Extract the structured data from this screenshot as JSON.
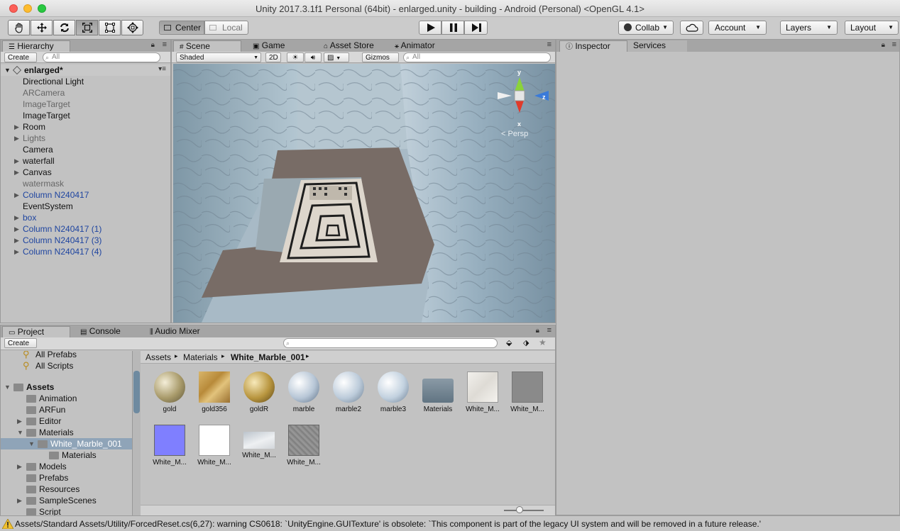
{
  "window": {
    "title": "Unity 2017.3.1f1 Personal (64bit) - enlarged.unity - building - Android (Personal) <OpenGL 4.1>"
  },
  "toolbar": {
    "pivot_center": "Center",
    "pivot_local": "Local",
    "collab": "Collab",
    "account": "Account",
    "layers": "Layers",
    "layout": "Layout"
  },
  "hierarchy": {
    "tab": "Hierarchy",
    "create": "Create",
    "search_placeholder": "All",
    "scene": "enlarged*",
    "items": [
      {
        "label": "Directional Light"
      },
      {
        "label": "ARCamera"
      },
      {
        "label": "ImageTarget"
      },
      {
        "label": "ImageTarget"
      },
      {
        "label": "Room"
      },
      {
        "label": "Lights"
      },
      {
        "label": "Camera"
      },
      {
        "label": "waterfall"
      },
      {
        "label": "Canvas"
      },
      {
        "label": "watermask"
      },
      {
        "label": "Column N240417"
      },
      {
        "label": "EventSystem"
      },
      {
        "label": "box"
      },
      {
        "label": "Column N240417 (1)"
      },
      {
        "label": "Column N240417 (3)"
      },
      {
        "label": "Column N240417 (4)"
      }
    ]
  },
  "scene_view": {
    "tabs": [
      "Scene",
      "Game",
      "Asset Store",
      "Animator"
    ],
    "shading": "Shaded",
    "mode_2d": "2D",
    "gizmos": "Gizmos",
    "search_placeholder": "All",
    "gizmo_y": "y",
    "gizmo_x": "x",
    "gizmo_z": "z",
    "persp": "Persp"
  },
  "inspector": {
    "tabs": [
      "Inspector",
      "Services"
    ]
  },
  "project": {
    "tabs": [
      "Project",
      "Console",
      "Audio Mixer"
    ],
    "create": "Create",
    "favorites": [
      "All Prefabs",
      "All Scripts"
    ],
    "tree": [
      {
        "label": "Assets"
      },
      {
        "label": "Animation"
      },
      {
        "label": "ARFun"
      },
      {
        "label": "Editor"
      },
      {
        "label": "Materials"
      },
      {
        "label": "White_Marble_001"
      },
      {
        "label": "Materials"
      },
      {
        "label": "Models"
      },
      {
        "label": "Prefabs"
      },
      {
        "label": "Resources"
      },
      {
        "label": "SampleScenes"
      },
      {
        "label": "Script"
      }
    ],
    "breadcrumb": [
      "Assets",
      "Materials",
      "White_Marble_001"
    ],
    "assets": [
      {
        "label": "gold"
      },
      {
        "label": "gold356"
      },
      {
        "label": "goldR"
      },
      {
        "label": "marble"
      },
      {
        "label": "marble2"
      },
      {
        "label": "marble3"
      },
      {
        "label": "Materials"
      },
      {
        "label": "White_M..."
      },
      {
        "label": "White_M..."
      },
      {
        "label": "White_M..."
      },
      {
        "label": "White_M..."
      },
      {
        "label": "White_M..."
      },
      {
        "label": "White_M..."
      }
    ]
  },
  "statusbar": {
    "message": "Assets/Standard Assets/Utility/ForcedReset.cs(6,27): warning CS0618: `UnityEngine.GUITexture' is obsolete: `This component is part of the legacy UI system and will be removed in a future release.'"
  }
}
